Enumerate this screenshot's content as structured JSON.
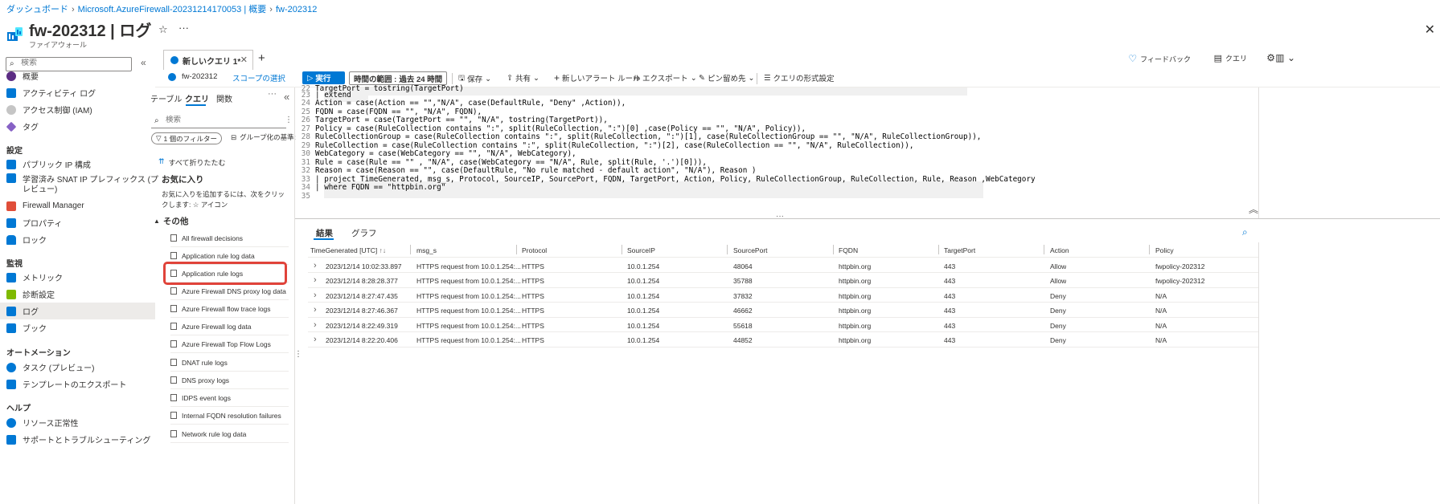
{
  "breadcrumb": [
    "ダッシュボード",
    "Microsoft.AzureFirewall-20231214170053 | 概要",
    "fw-202312"
  ],
  "header": {
    "title": "fw-202312 | ログ",
    "subtitle": "ファイアウォール"
  },
  "nav": {
    "search_placeholder": "検索",
    "items": [
      {
        "label": "概要",
        "color": "#5b2c83"
      },
      {
        "label": "アクティビティ ログ",
        "color": "#0078d4"
      },
      {
        "label": "アクセス制御 (IAM)",
        "color": "#0078d4"
      },
      {
        "label": "タグ",
        "color": "#8661c5"
      }
    ],
    "section_settings": "設定",
    "settings_items": [
      {
        "label": "パブリック IP 構成",
        "color": "#0078d4"
      },
      {
        "label": "学習済み SNAT IP プレフィックス (プ",
        "color": "#0078d4"
      },
      {
        "label": "レビュー)",
        "color": ""
      },
      {
        "label": "Firewall Manager",
        "color": "#e04e39"
      },
      {
        "label": "プロパティ",
        "color": "#0078d4"
      },
      {
        "label": "ロック",
        "color": "#0078d4"
      }
    ],
    "section_monitor": "監視",
    "monitor_items": [
      {
        "label": "メトリック",
        "color": "#0078d4"
      },
      {
        "label": "診断設定",
        "color": "#7fba00"
      },
      {
        "label": "ログ",
        "color": "#0078d4"
      },
      {
        "label": "ブック",
        "color": "#0078d4"
      }
    ],
    "section_automation": "オートメーション",
    "automation_items": [
      {
        "label": "タスク (プレビュー)",
        "color": "#0078d4"
      },
      {
        "label": "テンプレートのエクスポート",
        "color": "#0078d4"
      }
    ],
    "section_help": "ヘルプ",
    "help_items": [
      {
        "label": "リソース正常性",
        "color": "#0078d4"
      },
      {
        "label": "サポートとトラブルシューティング",
        "color": "#0078d4"
      }
    ]
  },
  "tabs": {
    "query_tab": "新しいクエリ 1*",
    "feedback": "フィードバック",
    "queries": "クエリ"
  },
  "toolbar": {
    "scope": "fw-202312",
    "scope_select": "スコープの選択",
    "run": "実行",
    "time_range_label": "時間の範囲 :",
    "time_range_value": "過去 24 時間",
    "save": "保存",
    "share": "共有",
    "new_alert": "新しいアラート ルール",
    "export": "エクスポート",
    "pin": "ピン留め先",
    "format": "クエリの形式設定"
  },
  "mid": {
    "tab_tables": "テーブル",
    "tab_queries": "クエリ",
    "tab_functions": "関数",
    "search_placeholder": "検索",
    "filter": "1 個のフィルター",
    "group_by": "グループ化の基準:",
    "collapse_all": "すべて折りたたむ",
    "favorites": "お気に入り",
    "favorites_desc": "お気に入りを追加するには、次をクリックします: ☆ アイコン",
    "other": "その他",
    "queries": [
      "All firewall decisions",
      "Application rule log data",
      "Application rule logs",
      "Azure Firewall DNS proxy log data",
      "Azure Firewall flow trace logs",
      "Azure Firewall log data",
      "Azure Firewall Top Flow Logs",
      "DNAT rule logs",
      "DNS proxy logs",
      "IDPS event logs",
      "Internal FQDN resolution failures",
      "Network rule log data"
    ]
  },
  "editor": {
    "lines": [
      {
        "n": "22",
        "code": "TargetPort = tostring(TargetPort)"
      },
      {
        "n": "23",
        "code": "| extend"
      },
      {
        "n": "24",
        "code": "Action = case(Action == \"\",\"N/A\", case(DefaultRule, \"Deny\" ,Action)),"
      },
      {
        "n": "25",
        "code": "FQDN = case(FQDN == \"\", \"N/A\", FQDN),"
      },
      {
        "n": "26",
        "code": "TargetPort = case(TargetPort == \"\", \"N/A\", tostring(TargetPort)),"
      },
      {
        "n": "27",
        "code": "Policy = case(RuleCollection contains \":\", split(RuleCollection, \":\")[0] ,case(Policy == \"\", \"N/A\", Policy)),"
      },
      {
        "n": "28",
        "code": "RuleCollectionGroup = case(RuleCollection contains \":\", split(RuleCollection, \":\")[1], case(RuleCollectionGroup == \"\", \"N/A\", RuleCollectionGroup)),"
      },
      {
        "n": "29",
        "code": "RuleCollection = case(RuleCollection contains \":\", split(RuleCollection, \":\")[2], case(RuleCollection == \"\", \"N/A\", RuleCollection)),"
      },
      {
        "n": "30",
        "code": "WebCategory = case(WebCategory == \"\", \"N/A\", WebCategory),"
      },
      {
        "n": "31",
        "code": "Rule = case(Rule == \"\" , \"N/A\", case(WebCategory == \"N/A\", Rule, split(Rule, '.')[0])),"
      },
      {
        "n": "32",
        "code": "Reason = case(Reason == \"\", case(DefaultRule, \"No rule matched - default action\", \"N/A\"), Reason )"
      },
      {
        "n": "33",
        "code": "| project TimeGenerated, msg_s, Protocol, SourceIP, SourcePort, FQDN, TargetPort, Action, Policy, RuleCollectionGroup, RuleCollection, Rule, Reason ,WebCategory"
      },
      {
        "n": "34",
        "code": "| where FQDN == \"httpbin.org\""
      },
      {
        "n": "35",
        "code": ""
      }
    ]
  },
  "results": {
    "tab_results": "結果",
    "tab_chart": "グラフ",
    "columns": [
      "TimeGenerated [UTC]",
      "msg_s",
      "Protocol",
      "SourceIP",
      "SourcePort",
      "FQDN",
      "TargetPort",
      "Action",
      "Policy"
    ],
    "sort_indicator": "↑↓",
    "rows": [
      [
        "2023/12/14 10:02:33.897",
        "HTTPS request from 10.0.1.254:...",
        "HTTPS",
        "10.0.1.254",
        "48064",
        "httpbin.org",
        "443",
        "Allow",
        "fwpolicy-202312"
      ],
      [
        "2023/12/14 8:28:28.377",
        "HTTPS request from 10.0.1.254:...",
        "HTTPS",
        "10.0.1.254",
        "35788",
        "httpbin.org",
        "443",
        "Allow",
        "fwpolicy-202312"
      ],
      [
        "2023/12/14 8:27:47.435",
        "HTTPS request from 10.0.1.254:...",
        "HTTPS",
        "10.0.1.254",
        "37832",
        "httpbin.org",
        "443",
        "Deny",
        "N/A"
      ],
      [
        "2023/12/14 8:27:46.367",
        "HTTPS request from 10.0.1.254:...",
        "HTTPS",
        "10.0.1.254",
        "46662",
        "httpbin.org",
        "443",
        "Deny",
        "N/A"
      ],
      [
        "2023/12/14 8:22:49.319",
        "HTTPS request from 10.0.1.254:...",
        "HTTPS",
        "10.0.1.254",
        "55618",
        "httpbin.org",
        "443",
        "Deny",
        "N/A"
      ],
      [
        "2023/12/14 8:22:20.406",
        "HTTPS request from 10.0.1.254:...",
        "HTTPS",
        "10.0.1.254",
        "44852",
        "httpbin.org",
        "443",
        "Deny",
        "N/A"
      ]
    ]
  },
  "colors": {
    "accent": "#0078d4",
    "highlight": "#e0433a"
  }
}
